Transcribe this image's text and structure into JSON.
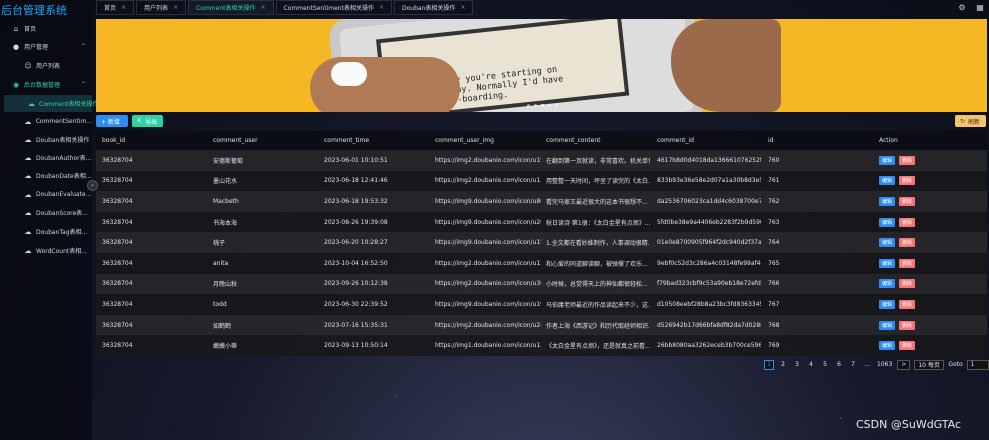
{
  "app": {
    "title": "后台管理系统"
  },
  "sidebar": {
    "items": [
      {
        "label": "首页",
        "icon": "home-icon"
      },
      {
        "label": "用户管理",
        "icon": "user-group-icon"
      },
      {
        "label": "用户列表",
        "icon": "user-icon"
      },
      {
        "label": "后台数据管理",
        "icon": "data-icon"
      },
      {
        "label": "Comment表相关操作",
        "icon": "cloud-icon"
      },
      {
        "label": "CommentSentim...",
        "icon": "cloud-icon"
      },
      {
        "label": "Douban表相关操作",
        "icon": "cloud-icon"
      },
      {
        "label": "DoubanAuthor表...",
        "icon": "cloud-icon"
      },
      {
        "label": "DoubanDate表相...",
        "icon": "cloud-icon"
      },
      {
        "label": "DoubanEvaluate...",
        "icon": "cloud-icon"
      },
      {
        "label": "DoubanScore表...",
        "icon": "cloud-icon"
      },
      {
        "label": "DoubanTag表相...",
        "icon": "cloud-icon"
      },
      {
        "label": "WordCount表相...",
        "icon": "cloud-icon"
      }
    ]
  },
  "tabs": [
    {
      "label": "首页"
    },
    {
      "label": "用户列表"
    },
    {
      "label": "Comment表相关操作"
    },
    {
      "label": "CommentSentiment表相关操作"
    },
    {
      "label": "Douban表相关操作"
    }
  ],
  "banner": {
    "screen_lines": [
      "I'm only sorry you're starting on",
      "such a busy day. Normally I'd have",
      "more of an on-boarding."
    ]
  },
  "toolbar": {
    "add_label": "+ 新增",
    "export_label": "导出",
    "refresh_label": "刷新"
  },
  "table": {
    "columns": [
      "book_id",
      "comment_user",
      "comment_time",
      "comment_user_img",
      "comment_content",
      "comment_id",
      "id",
      "Action"
    ],
    "rows": [
      [
        "36328704",
        "安德斯葡萄",
        "2023-06-01 10:10:51",
        "https://img2.doubanio.com/icon/u15...",
        "在翻到第一页就读，非常喜欢。机关单位...",
        "4617b8d0d4018da136661076252f85c...",
        "760"
      ],
      [
        "36328704",
        "墨山花水",
        "2023-06-18 12:41:46",
        "https://img2.doubanio.com/icon/u13...",
        "用整整一天时间，坪坐了读完的《太白...",
        "833b93e36e58e2d07a1a30b8d3e5fec8",
        "761"
      ],
      [
        "36328704",
        "Macbeth",
        "2023-06-18 19:53:32",
        "https://img9.doubanio.com/icon/u80...",
        "看完马家王最近很大的这本书很想不...",
        "da2536706023ca1dd4c6038700e788ec",
        "762"
      ],
      [
        "36328704",
        "书海本海",
        "2023-08-26 19:39:08",
        "https://img9.doubanio.com/icon/u26...",
        "秋日读诗·第1册：《太白金星有点烦》...",
        "5fd0be38e9a4406eb2283f2b9d5904d4",
        "763"
      ],
      [
        "36328704",
        "桃子",
        "2023-06-20 10:28:27",
        "https://img9.doubanio.com/icon/u15...",
        "1.全文都在看妙姝制作，人事调动很精...",
        "01e0e8700905f964f2dc940d2f37ae0f",
        "764"
      ],
      [
        "36328704",
        "anita",
        "2023-10-04 16:52:50",
        "https://img2.doubanio.com/icon/u13...",
        "和心爱的同道聊读聊，被弹撑了欢乐...",
        "9ebf0c52d3c286a4c03148fe99af4db8",
        "765"
      ],
      [
        "36328704",
        "月晚山秋",
        "2023-09-26 10:12:38",
        "https://img2.doubanio.com/icon/u38...",
        "小时候，总觉得天上的神仙都很轻松...",
        "f79bad323cbf9c53a90eb18e72efd753",
        "766"
      ],
      [
        "36328704",
        "todd",
        "2023-06-30 22:39:52",
        "https://img9.doubanio.com/icon/u19...",
        "马伯庸老师最近的作品读起来不少，这...",
        "d10508eebf28b8a23bc3fd8363345b50",
        "767"
      ],
      [
        "36328704",
        "如鹤鹤",
        "2023-07-16 15:35:31",
        "https://img2.doubanio.com/icon/u24...",
        "作者上海《西游记》和历代取经师相识...",
        "d526942b17d66bfa8df82da7d0288db9",
        "768"
      ],
      [
        "36328704",
        "嫩嫩小蒂",
        "2023-09-13 10:50:14",
        "https://img1.doubanio.com/icon/u12...",
        "《太白金星有点烦》，还是就真之前看...",
        "26bb8080aa3262eceb3b700ce596eecd",
        "769"
      ]
    ],
    "edit_label": "编辑",
    "delete_label": "删除"
  },
  "pagination": {
    "pages": [
      "1",
      "2",
      "3",
      "4",
      "5",
      "6",
      "7",
      "...",
      "1063"
    ],
    "current": "1",
    "prev": "<",
    "next": ">",
    "page_size": "10 每页",
    "goto_label": "Goto",
    "goto_value": "1"
  },
  "watermark": "CSDN @SuWdGTAc"
}
